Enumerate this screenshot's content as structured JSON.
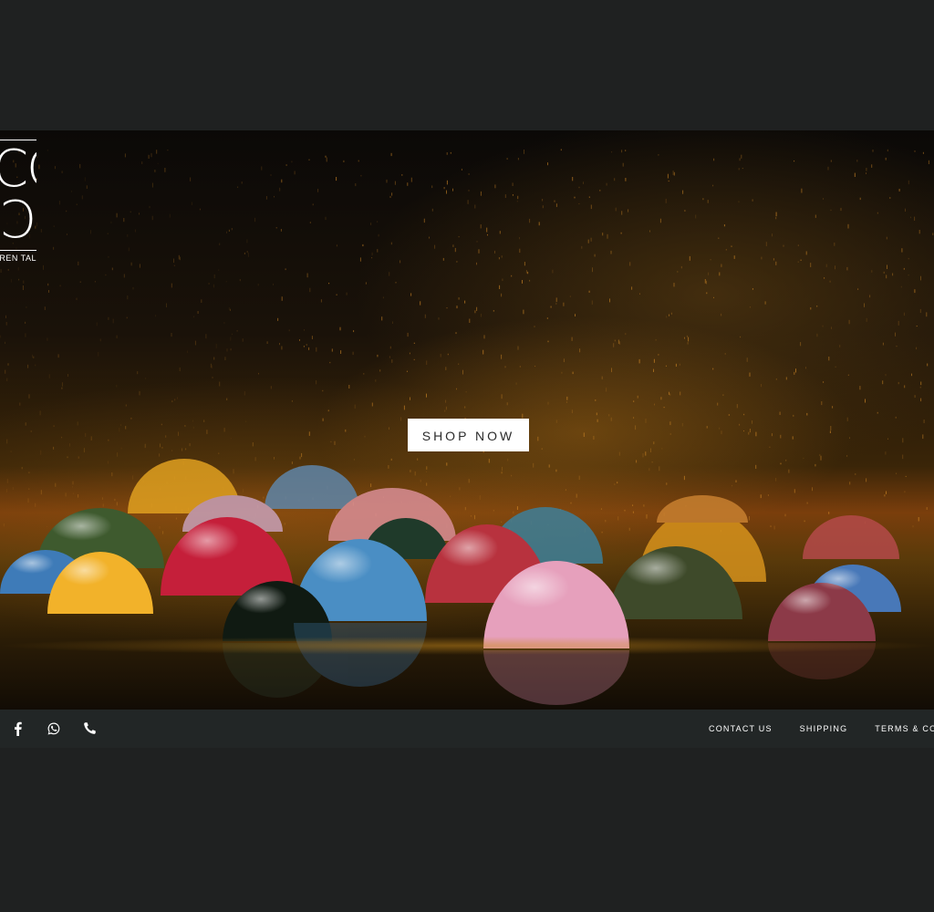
{
  "brand": {
    "logo_line1": "CO",
    "logo_line2": "CO",
    "tagline": "EREN TAL"
  },
  "hero": {
    "image": "chocolate-bonbons-with-gold-dust",
    "cta_label": "SHOP NOW"
  },
  "footer": {
    "social": [
      {
        "icon": "facebook-icon"
      },
      {
        "icon": "whatsapp-icon"
      },
      {
        "icon": "phone-icon"
      }
    ],
    "links": [
      {
        "label": "CONTACT US"
      },
      {
        "label": "SHIPPING"
      },
      {
        "label": "TERMS & CONDITI"
      }
    ]
  },
  "colors": {
    "page_background": "#1f2121",
    "footer_background": "#222626",
    "button_background": "#ffffff",
    "button_text": "#2b2b2b"
  }
}
